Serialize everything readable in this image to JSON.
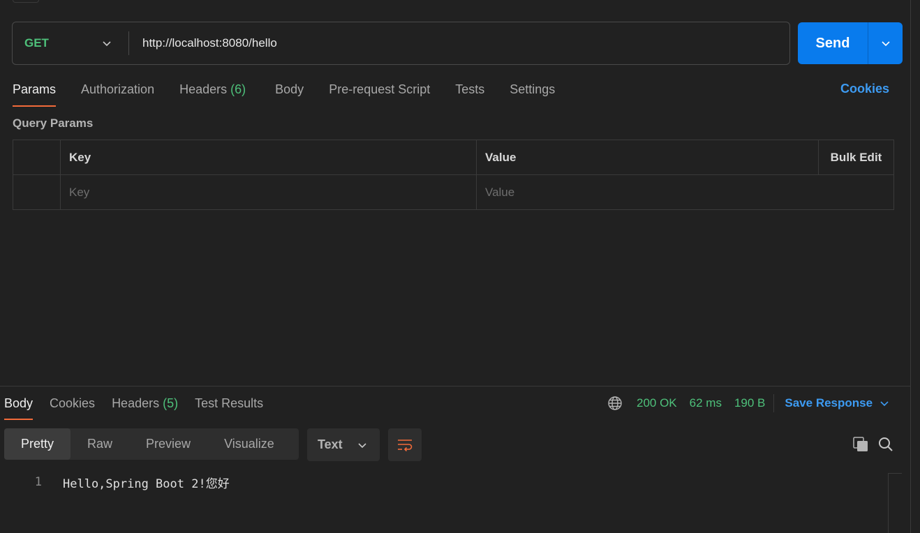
{
  "request": {
    "method": "GET",
    "url": "http://localhost:8080/hello",
    "send_label": "Send"
  },
  "request_tabs": [
    {
      "label": "Params",
      "count": ""
    },
    {
      "label": "Authorization",
      "count": ""
    },
    {
      "label": "Headers",
      "count": "(6)"
    },
    {
      "label": "Body",
      "count": ""
    },
    {
      "label": "Pre-request Script",
      "count": ""
    },
    {
      "label": "Tests",
      "count": ""
    },
    {
      "label": "Settings",
      "count": ""
    }
  ],
  "cookies_link": "Cookies",
  "query_params": {
    "title": "Query Params",
    "headers": {
      "key": "Key",
      "value": "Value",
      "bulk_edit": "Bulk Edit"
    },
    "placeholder": {
      "key": "Key",
      "value": "Value"
    }
  },
  "response_tabs": [
    {
      "label": "Body",
      "count": ""
    },
    {
      "label": "Cookies",
      "count": ""
    },
    {
      "label": "Headers",
      "count": "(5)"
    },
    {
      "label": "Test Results",
      "count": ""
    }
  ],
  "status": {
    "code": "200 OK",
    "time": "62 ms",
    "size": "190 B",
    "save_response": "Save Response"
  },
  "format_options": [
    "Pretty",
    "Raw",
    "Preview",
    "Visualize"
  ],
  "response_type": "Text",
  "response_body": [
    {
      "line": "1",
      "text": "Hello,Spring Boot 2!您好"
    }
  ],
  "colors": {
    "accent": "#f26b3a",
    "send": "#097bed",
    "success": "#4ec07a",
    "link": "#3d9bf2"
  }
}
